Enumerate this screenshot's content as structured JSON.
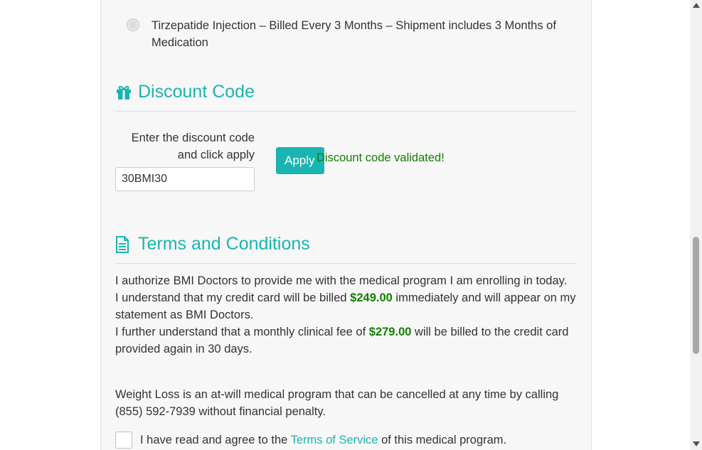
{
  "plan_option": {
    "label": "Tirzepatide Injection – Billed Every 3 Months – Shipment includes 3 Months of Medication"
  },
  "discount": {
    "title": "Discount Code",
    "icon": "gift-icon",
    "prompt": "Enter the discount code and click apply",
    "code_value": "30BMI30",
    "apply_label": "Apply",
    "validated_message": "Discount code validated!"
  },
  "terms": {
    "title": "Terms and Conditions",
    "icon": "document-icon",
    "p1_a": "I authorize BMI Doctors to provide me with the medical program I am enrolling in today.",
    "p1_b_pre": "I understand that my credit card will be billed ",
    "p1_b_amount": "$249.00",
    "p1_b_post": " immediately and will appear on my statement as BMI Doctors.",
    "p1_c_pre": "I further understand that a monthly clinical fee of ",
    "p1_c_amount": "$279.00",
    "p1_c_post": " will be billed to the credit card provided again in 30 days.",
    "p2": "Weight Loss is an at-will medical program that can be cancelled at any time by calling (855) 592-7939 without financial penalty.",
    "agree_pre": "I have read and agree to the ",
    "agree_link": "Terms of Service",
    "agree_post": " of this medical program."
  },
  "colors": {
    "accent": "#1ab5b0",
    "success": "#138000"
  }
}
